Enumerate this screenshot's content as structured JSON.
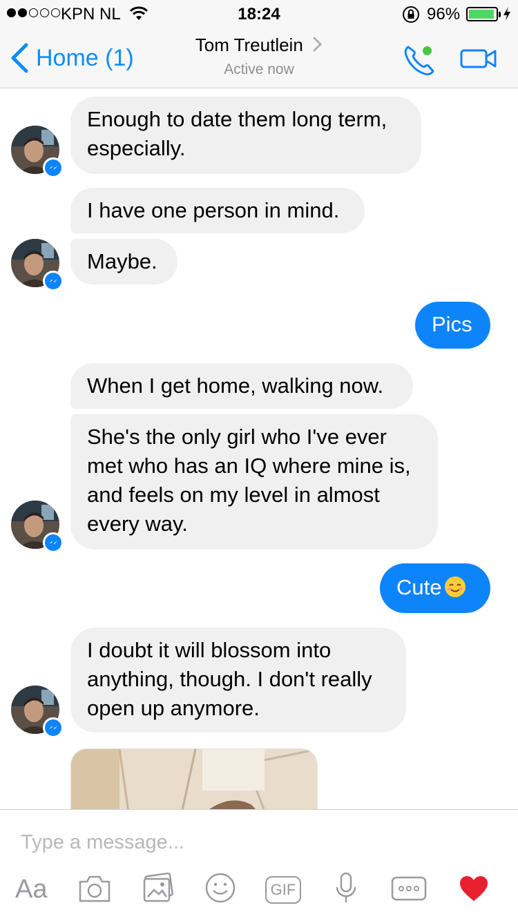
{
  "status_bar": {
    "carrier": "KPN NL",
    "time": "18:24",
    "battery_percent": "96%",
    "signal_bars": 2,
    "signal_total": 5
  },
  "nav": {
    "back_label": "Home (1)",
    "contact_name": "Tom Treutlein",
    "status": "Active now"
  },
  "messages": [
    {
      "from": "them",
      "text": "Enough to date them long term, especially."
    },
    {
      "from": "them",
      "text": "I have one person in mind."
    },
    {
      "from": "them",
      "text": "Maybe."
    },
    {
      "from": "me",
      "text": "Pics"
    },
    {
      "from": "them",
      "text": "When I get home, walking now."
    },
    {
      "from": "them",
      "text": "She's the only girl who I've ever met who has an IQ where mine is, and feels on my level in almost every way."
    },
    {
      "from": "me",
      "text": "Cute",
      "emoji": "smiling-face-emoji"
    },
    {
      "from": "them",
      "text": "I doubt it will blossom into anything, though. I don't really open up anymore."
    },
    {
      "from": "them",
      "type": "photo"
    }
  ],
  "composer": {
    "placeholder": "Type a message...",
    "aa_label": "Aa",
    "gif_label": "GIF"
  },
  "colors": {
    "accent": "#0e84fb",
    "incoming_bubble": "#f1f0f0",
    "like_heart": "#e8202f",
    "online": "#44c93f"
  },
  "icons": [
    "back-chevron-icon",
    "phone-icon",
    "video-camera-icon",
    "messenger-badge-icon",
    "camera-icon",
    "photo-gallery-icon",
    "emoji-icon",
    "microphone-icon",
    "more-icon",
    "heart-icon"
  ]
}
